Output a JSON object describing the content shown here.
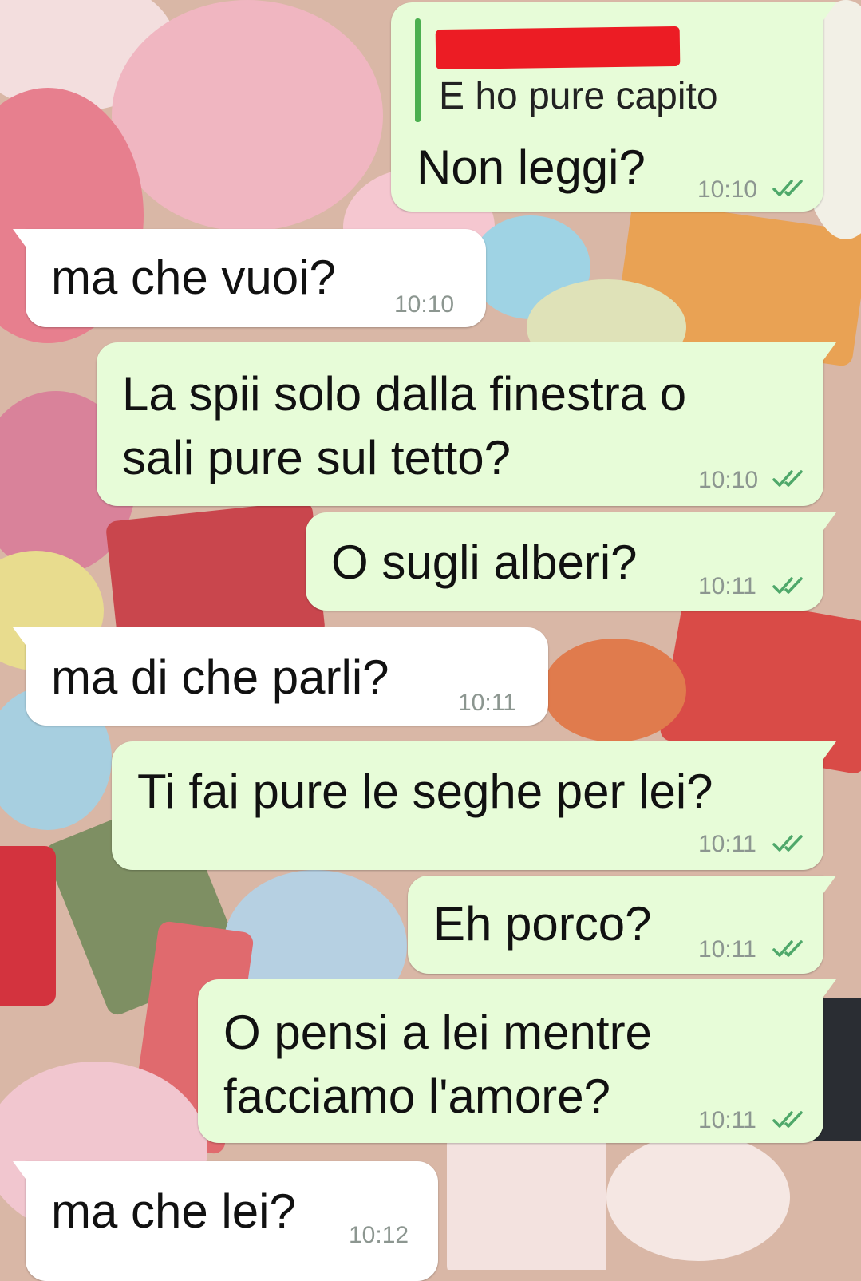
{
  "conversation": {
    "messages": [
      {
        "direction": "outgoing",
        "quoted_text": "E ho pure capito",
        "text": "Non leggi?",
        "time": "10:10",
        "status": "double-check-icon"
      },
      {
        "direction": "incoming",
        "text": "ma che vuoi?",
        "time": "10:10"
      },
      {
        "direction": "outgoing",
        "text_lines": [
          "La spii solo dalla finestra o",
          "sali pure sul tetto?"
        ],
        "time": "10:10",
        "status": "double-check-icon"
      },
      {
        "direction": "outgoing",
        "text": "O sugli alberi?",
        "time": "10:11",
        "status": "double-check-icon"
      },
      {
        "direction": "incoming",
        "text": "ma di che parli?",
        "time": "10:11"
      },
      {
        "direction": "outgoing",
        "text": "Ti fai pure le seghe per lei?",
        "time": "10:11",
        "status": "double-check-icon"
      },
      {
        "direction": "outgoing",
        "text": "Eh porco?",
        "time": "10:11",
        "status": "double-check-icon"
      },
      {
        "direction": "outgoing",
        "text_lines": [
          "O pensi a lei mentre",
          "facciamo l'amore?"
        ],
        "time": "10:11",
        "status": "double-check-icon"
      },
      {
        "direction": "incoming",
        "text": "ma che lei?",
        "time": "10:12"
      }
    ]
  },
  "colors": {
    "outgoing_bubble": "#e7fcd8",
    "incoming_bubble": "#ffffff",
    "quote_bar": "#4caf50",
    "redaction": "#ec1c24",
    "ticks": "#4fa86a",
    "meta_text": "#8c9690"
  }
}
